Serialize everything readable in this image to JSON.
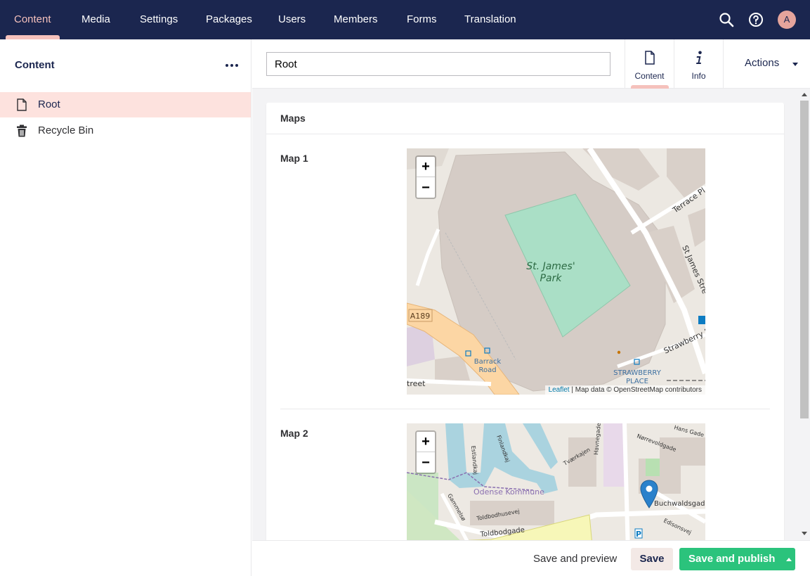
{
  "nav": {
    "items": [
      {
        "label": "Content",
        "active": true
      },
      {
        "label": "Media"
      },
      {
        "label": "Settings"
      },
      {
        "label": "Packages"
      },
      {
        "label": "Users"
      },
      {
        "label": "Members"
      },
      {
        "label": "Forms"
      },
      {
        "label": "Translation"
      }
    ],
    "user_initial": "A",
    "icons": [
      "search-icon",
      "help-icon"
    ]
  },
  "sidebar": {
    "title": "Content",
    "tree": [
      {
        "label": "Root",
        "icon": "document-icon",
        "selected": true
      },
      {
        "label": "Recycle Bin",
        "icon": "trash-icon"
      }
    ]
  },
  "editor": {
    "name_value": "Root",
    "tabs": [
      {
        "label": "Content",
        "icon": "document-icon",
        "active": true
      },
      {
        "label": "Info",
        "icon": "info-icon"
      }
    ],
    "actions_label": "Actions"
  },
  "panel": {
    "title": "Maps",
    "properties": [
      {
        "label": "Map 1",
        "map_labels": [
          "St. James'",
          "Park",
          "A189",
          "Barrack",
          "Road",
          "STRAWBERRY",
          "PLACE",
          "Terrace Pl",
          "St James Stre",
          "Strawberry P",
          "treet"
        ],
        "attribution": {
          "link": "Leaflet",
          "text": " | Map data © OpenStreetMap contributors"
        }
      },
      {
        "label": "Map 2",
        "map_labels": [
          "Odense Kommune",
          "Buchwaldsgade",
          "Toldbodgade",
          "Toldbodhusevej",
          "Tværkajen",
          "Havnegade",
          "Gammelsø",
          "Nørrevoldgade",
          "Edisonsvej",
          "Finlandkaj",
          "Estlandkaj",
          "Hans Gade"
        ]
      }
    ]
  },
  "zoom": {
    "in": "+",
    "out": "−"
  },
  "footer": {
    "save_preview": "Save and preview",
    "save": "Save",
    "save_publish": "Save and publish"
  },
  "colors": {
    "nav_bg": "#1b264f",
    "accent": "#f5c1bc",
    "selected_bg": "#fde2de",
    "publish_green": "#2bc37c",
    "pitch": "#aadfc6",
    "water": "#aad3df"
  }
}
